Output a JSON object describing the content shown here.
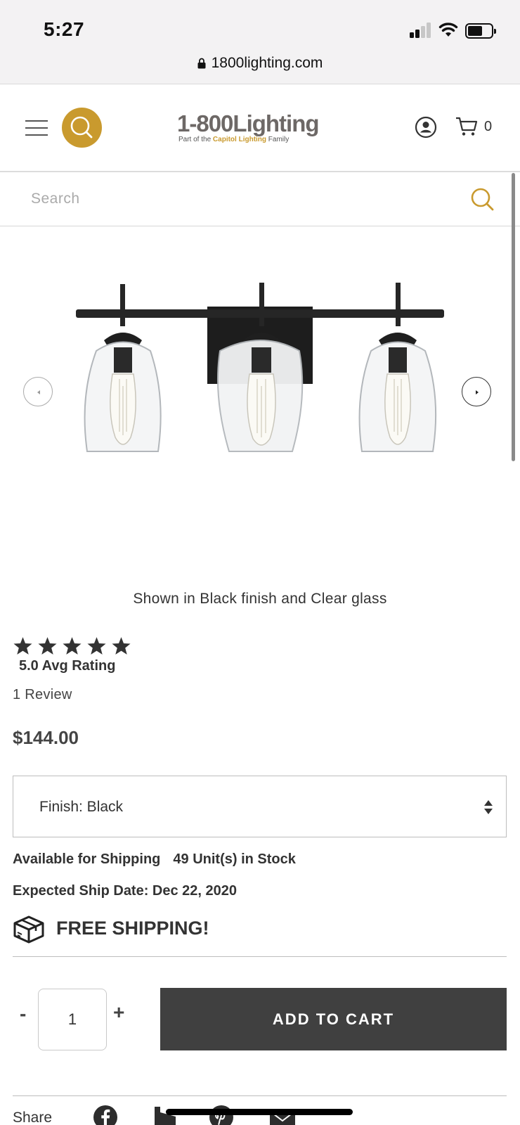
{
  "status_bar": {
    "time": "5:27",
    "url": "1800lighting.com",
    "icons": [
      "cellular-signal-icon",
      "wifi-icon",
      "battery-icon",
      "lock-icon"
    ]
  },
  "header": {
    "logo_main_part1": "1-800",
    "logo_main_part2": "Lighting",
    "logo_sub_prefix": "Part of the",
    "logo_sub_brand": "Capitol Lighting",
    "logo_sub_suffix": "Family",
    "cart_count": "0",
    "icons": [
      "menu-icon",
      "search-icon",
      "account-icon",
      "cart-icon"
    ]
  },
  "search": {
    "placeholder": "Search"
  },
  "product": {
    "caption": "Shown in Black finish and Clear glass",
    "rating_value": 5,
    "rating_max": 5,
    "avg_rating_text": "5.0 Avg Rating",
    "reviews_text": "1 Review",
    "price": "$144.00",
    "finish_label": "Finish: Black",
    "availability": "Available for Shipping",
    "stock": "49 Unit(s) in Stock",
    "ship_date": "Expected Ship Date: Dec 22, 2020",
    "free_shipping": "FREE SHIPPING!"
  },
  "cart": {
    "minus": "-",
    "plus": "+",
    "quantity": "1",
    "add_to_cart": "ADD TO CART"
  },
  "share": {
    "label": "Share",
    "icons": [
      "facebook-icon",
      "houzz-icon",
      "pinterest-icon",
      "email-icon"
    ]
  },
  "colors": {
    "brand_gold": "#c99a2e",
    "button_dark": "#404040",
    "text_dark": "#333333"
  }
}
